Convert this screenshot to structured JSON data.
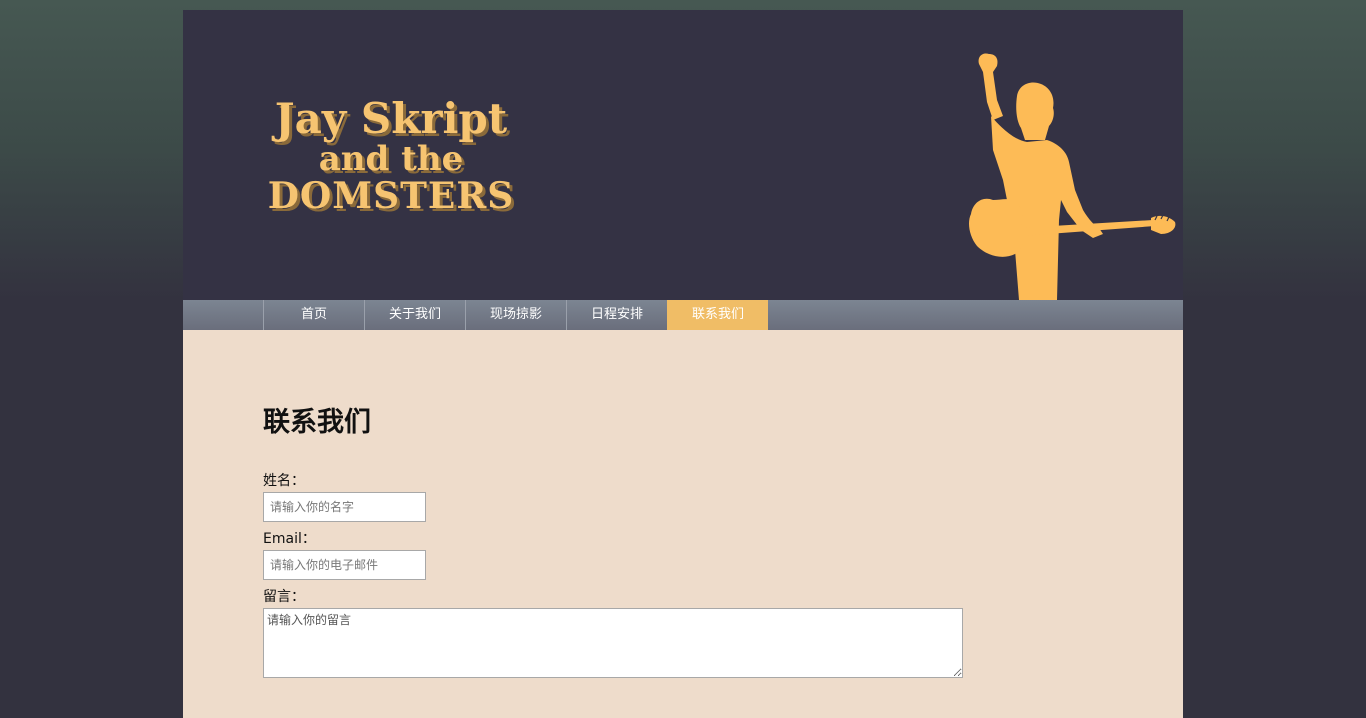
{
  "header": {
    "logo_line1": "Jay Skript",
    "logo_line2": "and the",
    "logo_line3": "DOMSTERS",
    "accent_color": "#f6c471",
    "background_color": "#343244"
  },
  "nav": {
    "items": [
      {
        "label": "首页"
      },
      {
        "label": "关于我们"
      },
      {
        "label": "现场掠影"
      },
      {
        "label": "日程安排"
      },
      {
        "label": "联系我们"
      }
    ],
    "active_index": 4,
    "active_color": "#f0bd66"
  },
  "content": {
    "title": "联系我们",
    "form": {
      "name_label": "姓名：",
      "name_placeholder": "请输入你的名字",
      "email_label": "Email：",
      "email_placeholder": "请输入你的电子邮件",
      "message_label": "留言：",
      "message_placeholder": "请输入你的留言"
    }
  }
}
